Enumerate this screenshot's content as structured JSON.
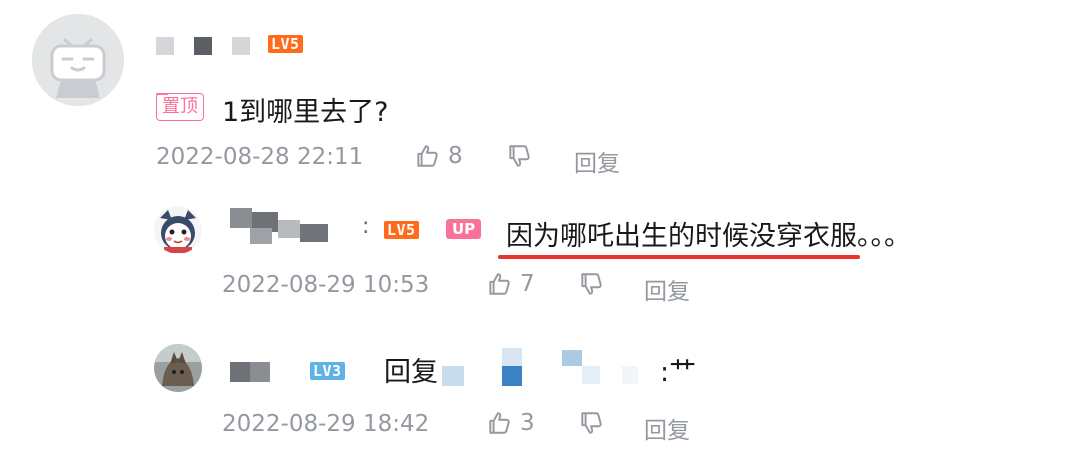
{
  "comment": {
    "level_badge": "LV5",
    "pinned_tag": "置顶",
    "text": "1到哪里去了?",
    "timestamp": "2022-08-28 22:11",
    "like_count": "8",
    "reply_label": "回复"
  },
  "replies": [
    {
      "separator": ":",
      "level_badge": "LV5",
      "up_badge": "UP",
      "text": "因为哪吒出生的时候没穿衣服。。。",
      "timestamp": "2022-08-29 10:53",
      "like_count": "7",
      "reply_label": "回复"
    },
    {
      "level_badge": "LV3",
      "reply_prefix": "回复",
      "trailing": ":艹",
      "timestamp": "2022-08-29 18:42",
      "like_count": "3",
      "reply_label": "回复"
    }
  ],
  "icons": {
    "like": "thumbs-up-icon",
    "dislike": "thumbs-down-icon"
  },
  "colors": {
    "accent_pink": "#fb7299",
    "level5": "#ff6b1a",
    "level3": "#5fb2e6",
    "meta_gray": "#9499a0",
    "underline_red": "#e8332a"
  }
}
